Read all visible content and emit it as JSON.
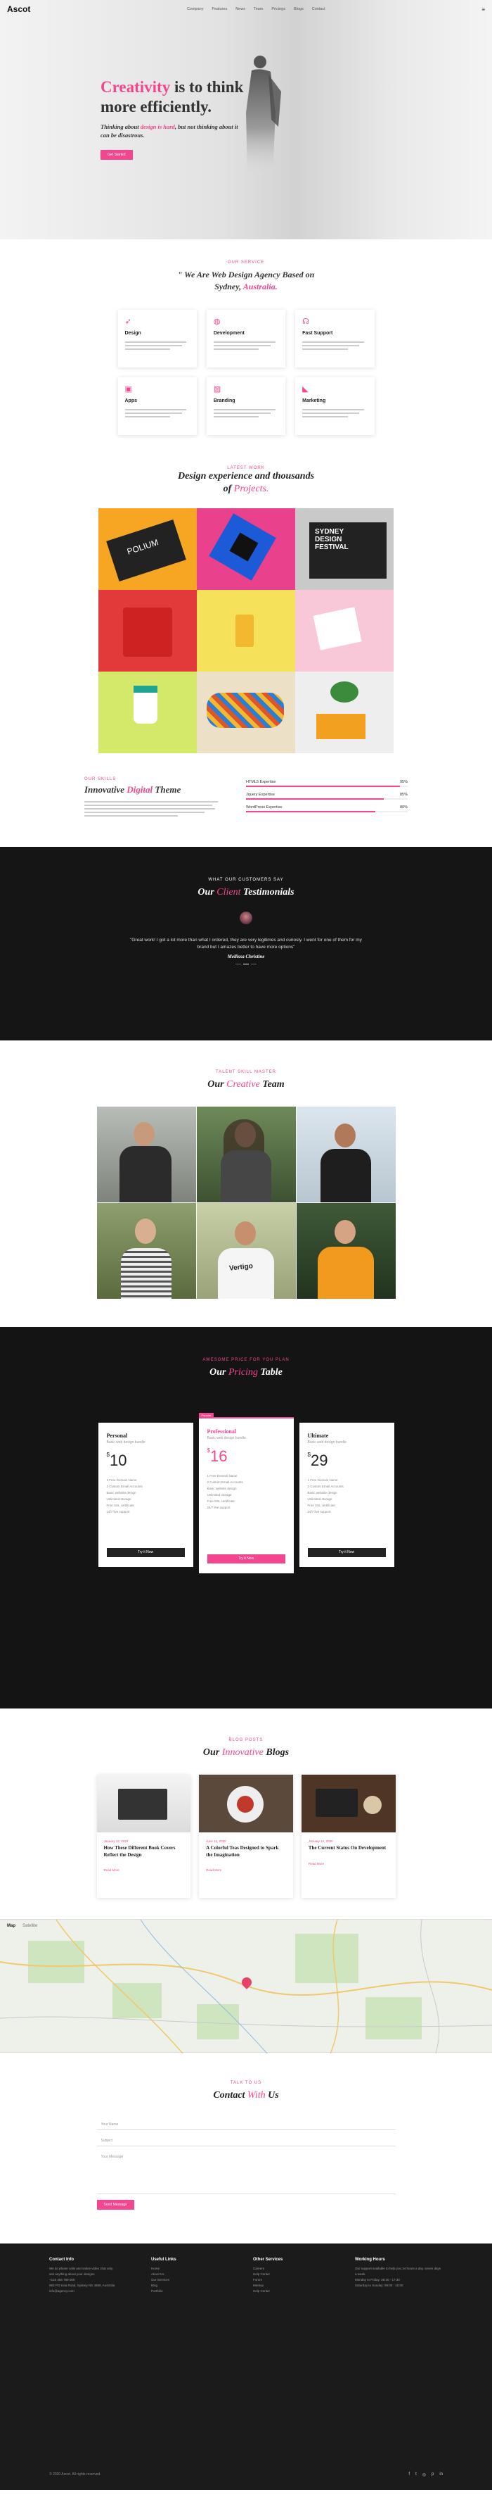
{
  "nav": {
    "logo": "Ascot",
    "items": [
      "Company",
      "Features",
      "News",
      "Team",
      "Pricings",
      "Blogs",
      "Contact"
    ],
    "icon": "hamburger-icon"
  },
  "hero": {
    "title_pink": "Creativity",
    "title_rest1": "is to think",
    "title_rest2": "more efficiently.",
    "sub_a": "Thinking about",
    "sub_pink": "design is hard",
    "sub_b": ", but not thinking about it",
    "sub_c": "can be disastrous.",
    "button": "Get Started"
  },
  "services": {
    "eyebrow": "Our Service",
    "title_a": "\" We Are Web Design Agency Based on",
    "title_b": "Sydney,",
    "title_pink": "Australia.",
    "cards": [
      {
        "icon": "rocket-icon",
        "title": "Design"
      },
      {
        "icon": "globe-icon",
        "title": "Development"
      },
      {
        "icon": "headset-icon",
        "title": "Fast Support"
      },
      {
        "icon": "apps-icon",
        "title": "Apps"
      },
      {
        "icon": "image-icon",
        "title": "Branding"
      },
      {
        "icon": "megaphone-icon",
        "title": "Marketing"
      }
    ]
  },
  "portfolio": {
    "eyebrow": "Latest Work",
    "title_a": "Design experience and thousands",
    "title_b": "of",
    "title_pink": "Projects."
  },
  "skills": {
    "eyebrow": "Our Skills",
    "title_a": "Innovative",
    "title_pink": "Digital",
    "title_b": "Theme",
    "bars": [
      {
        "label": "HTML5 Expertise",
        "value": "95%",
        "fraction": 0.95
      },
      {
        "label": "Jquery Expertise",
        "value": "85%",
        "fraction": 0.85
      },
      {
        "label": "WordPress Expertise",
        "value": "80%",
        "fraction": 0.8
      }
    ]
  },
  "testimonials": {
    "eyebrow": "What our customers say",
    "title_a": "Our",
    "title_pink": "Client",
    "title_b": "Testimonials",
    "quote": "\"Great work! I got a lot more than what I ordered, they are very legitimes and curiosly. I went for one of them for my brand but I amazes better to have more options\"",
    "name": "Mellissa Christine"
  },
  "team": {
    "eyebrow": "Talent Skill Master",
    "title_a": "Our",
    "title_pink": "Creative",
    "title_b": "Team"
  },
  "pricing": {
    "eyebrow": "Awesome Price for you Plan",
    "title_a": "Our",
    "title_pink": "Pricing",
    "title_b": "Table",
    "plans": [
      {
        "name": "Personal",
        "desc": "Basic web design bundle",
        "currency": "$",
        "amount": "10",
        "features": [
          "1 Free Domain Name",
          "2 Custom Email Accounts",
          "Basic website design",
          "Unlimited storage",
          "Free SSL certificate",
          "24/7 live support"
        ],
        "button": "Try it Now"
      },
      {
        "name": "Professional",
        "desc": "Basic web design bundle",
        "currency": "$",
        "amount": "16",
        "features": [
          "1 Free Domain Name",
          "2 Custom Email Accounts",
          "Basic website design",
          "Unlimited storage",
          "Free SSL certificate",
          "24/7 live support"
        ],
        "button": "Try it Now",
        "ribbon": "Popular"
      },
      {
        "name": "Ultimate",
        "desc": "Basic web design bundle",
        "currency": "$",
        "amount": "29",
        "features": [
          "1 Free Domain Name",
          "2 Custom Email Accounts",
          "Basic website design",
          "Unlimited storage",
          "Free SSL certificate",
          "24/7 live support"
        ],
        "button": "Try it Now"
      }
    ]
  },
  "blog": {
    "eyebrow": "Blog Posts",
    "title_a": "Our",
    "title_pink": "Innovative",
    "title_b": "Blogs",
    "posts": [
      {
        "meta": "January 12, 2020",
        "title": "How These Different Book Covers Reflect the Design",
        "more": "Read More"
      },
      {
        "meta": "June 12, 2020",
        "title": "A Colorful Teas Designed to Spark the Imagination",
        "more": "Read More"
      },
      {
        "meta": "January 12, 2020",
        "title": "The Current Status On Development",
        "more": "Read More"
      }
    ]
  },
  "map": {
    "tabs": [
      "Map",
      "Satellite"
    ]
  },
  "contact": {
    "eyebrow": "Talk To Us",
    "title_a": "Contact",
    "title_pink": "With",
    "title_b": "Us",
    "fields": [
      "Your Name",
      "Subject",
      "Your Message"
    ],
    "button": "Send Message"
  },
  "footer": {
    "cols": [
      {
        "title": "Contact Info",
        "lines": [
          "We do phone calls and online video chat only.",
          "ask anything about your designs",
          "+123 456 789 000",
          "983 PO Kisa Road, Sydney NS 4568, Australia",
          "info@agency.com"
        ]
      },
      {
        "title": "Useful Links",
        "lines": [
          "Home",
          "About Us",
          "Our Services",
          "Blog",
          "Portfolio"
        ]
      },
      {
        "title": "Other Services",
        "lines": [
          "Careers",
          "Help Center",
          "Forum",
          "Meetup",
          "Help Center"
        ]
      },
      {
        "title": "Working Hours",
        "lines": [
          "Our support available to help you 24 hours a day, seven days a week.",
          "Monday to Friday: 08:30 - 17:30",
          "Saturday to Sunday: 09:00 - 15:00"
        ]
      }
    ],
    "copyright": "© 2020 Ascot. All rights reserved.",
    "social": [
      "facebook-icon",
      "twitter-icon",
      "instagram-icon",
      "pinterest-icon",
      "linkedin-icon"
    ]
  }
}
